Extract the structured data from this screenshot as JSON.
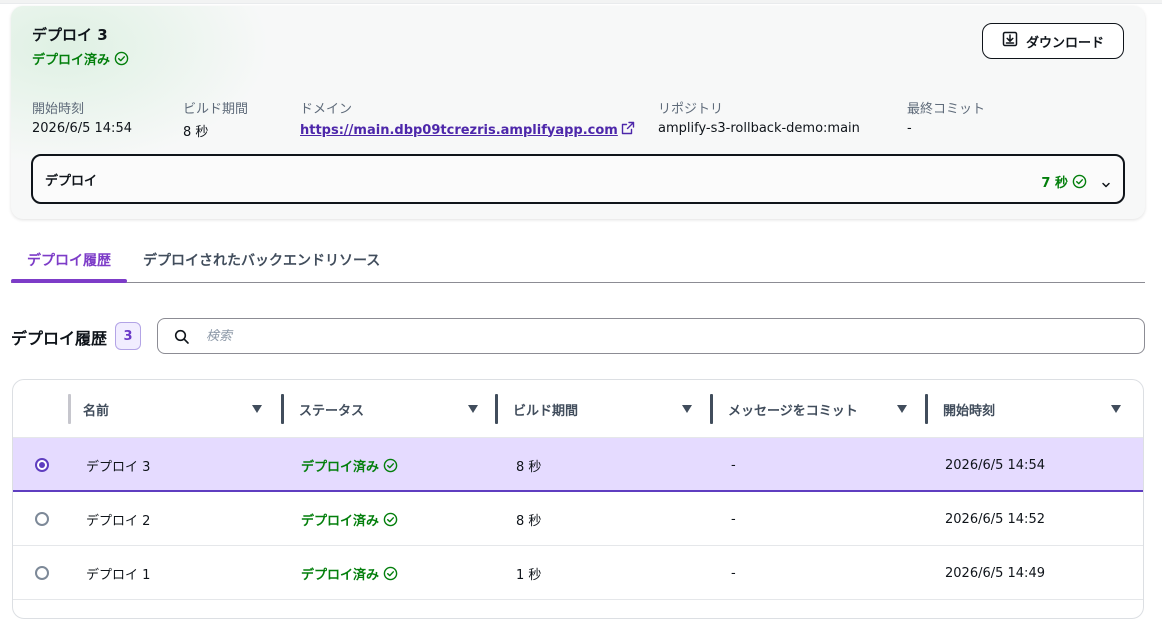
{
  "deploy": {
    "title": "デプロイ 3",
    "status": "デプロイ済み",
    "download_label": "ダウンロード",
    "meta": {
      "start_label": "開始時刻",
      "start_value": "2026/6/5 14:54",
      "build_label": "ビルド期間",
      "build_value": "8 秒",
      "domain_label": "ドメイン",
      "domain_value": "https://main.dbp09tcrezris.amplifyapp.com",
      "repo_label": "リポジトリ",
      "repo_value": "amplify-s3-rollback-demo:main",
      "commit_label": "最終コミット",
      "commit_value": "-"
    },
    "step": {
      "label": "デプロイ",
      "duration": "7 秒"
    }
  },
  "tabs": [
    {
      "label": "デプロイ履歴",
      "active": true
    },
    {
      "label": "デプロイされたバックエンドリソース",
      "active": false
    }
  ],
  "history": {
    "title": "デプロイ履歴",
    "count": "3",
    "search_placeholder": "検索"
  },
  "table": {
    "columns": [
      "名前",
      "ステータス",
      "ビルド期間",
      "メッセージをコミット",
      "開始時刻"
    ],
    "rows": [
      {
        "name": "デプロイ 3",
        "status": "デプロイ済み",
        "build": "8 秒",
        "message": "-",
        "start": "2026/6/5 14:54",
        "selected": true
      },
      {
        "name": "デプロイ 2",
        "status": "デプロイ済み",
        "build": "8 秒",
        "message": "-",
        "start": "2026/6/5 14:52",
        "selected": false
      },
      {
        "name": "デプロイ 1",
        "status": "デプロイ済み",
        "build": "1 秒",
        "message": "-",
        "start": "2026/6/5 14:49",
        "selected": false
      }
    ]
  },
  "colors": {
    "success": "#037f0c",
    "accent": "#7d3cc8",
    "link": "#4d27aa",
    "selected_row": "#e5dbff"
  }
}
